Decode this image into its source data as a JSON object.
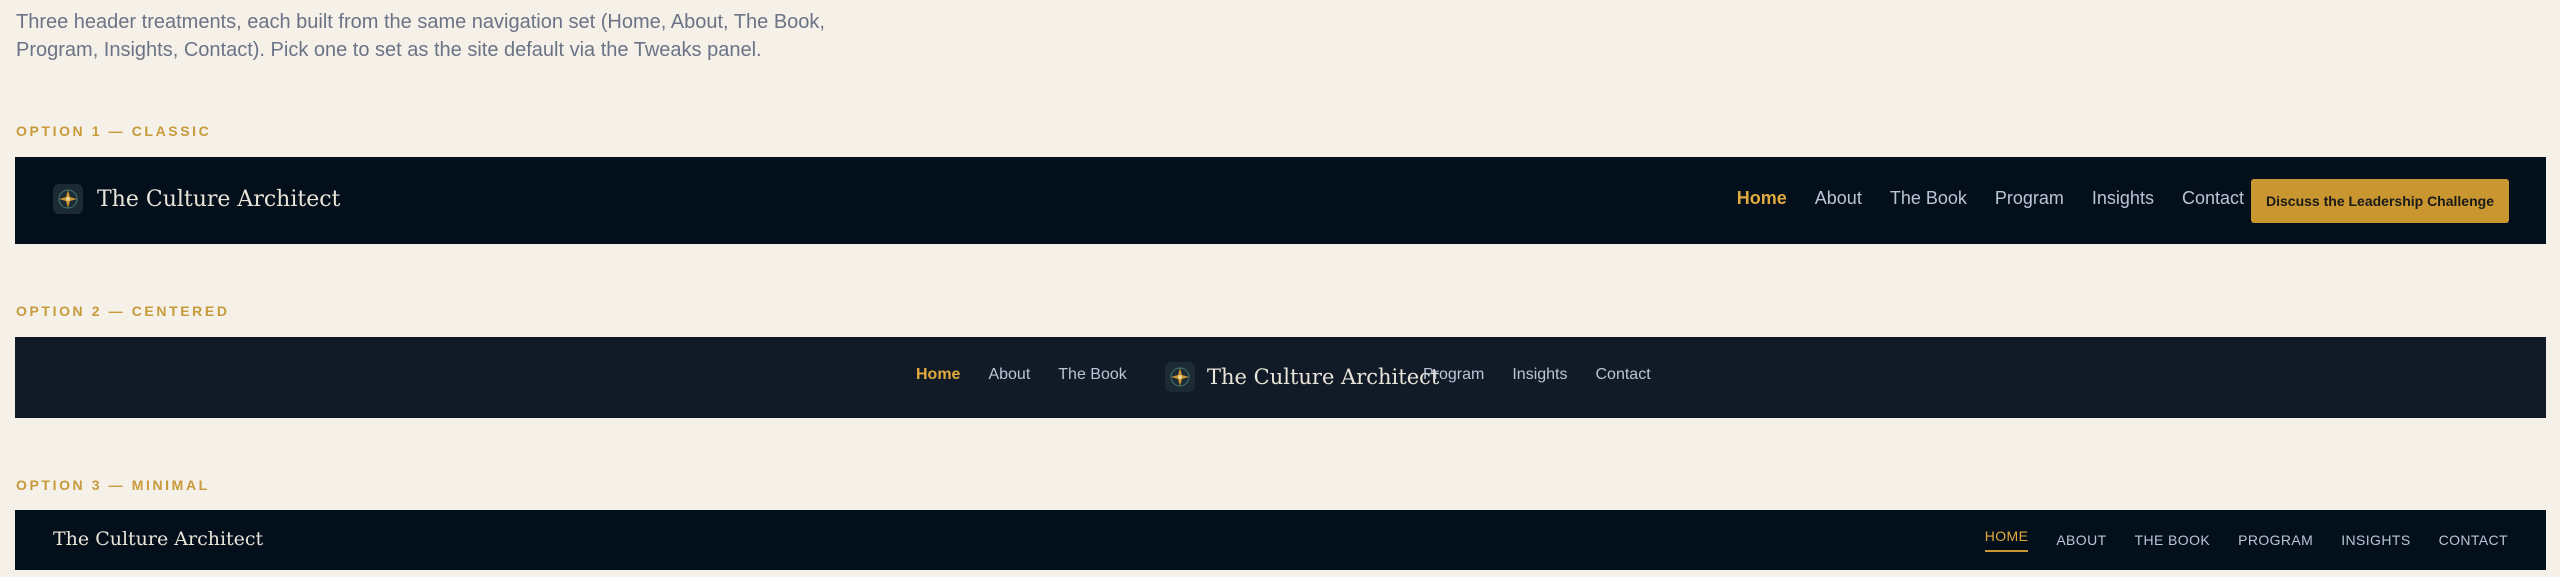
{
  "intro": "Three header treatments, each built from the same navigation set (Home, About, The Book, Program, Insights, Contact). Pick one to set as the site default via the Tweaks panel.",
  "brand_name": "The Culture Architect",
  "colors": {
    "background": "#f5f0e8",
    "navy": "#040f1c",
    "navy_alt": "#111b28",
    "gold": "#c9962f",
    "active_link": "#e0aa3e"
  },
  "option1": {
    "label": "OPTION 1 — CLASSIC",
    "nav": [
      "Home",
      "About",
      "The Book",
      "Program",
      "Insights",
      "Contact"
    ],
    "cta": "Discuss the Leadership Challenge"
  },
  "option2": {
    "label": "OPTION 2 — CENTERED",
    "nav_left": [
      "Home",
      "About",
      "The Book"
    ],
    "nav_right": [
      "Program",
      "Insights",
      "Contact"
    ]
  },
  "option3": {
    "label": "OPTION 3 — MINIMAL",
    "nav": [
      "HOME",
      "ABOUT",
      "THE BOOK",
      "PROGRAM",
      "INSIGHTS",
      "CONTACT"
    ]
  },
  "icons": {
    "logo": "compass-star-icon"
  }
}
